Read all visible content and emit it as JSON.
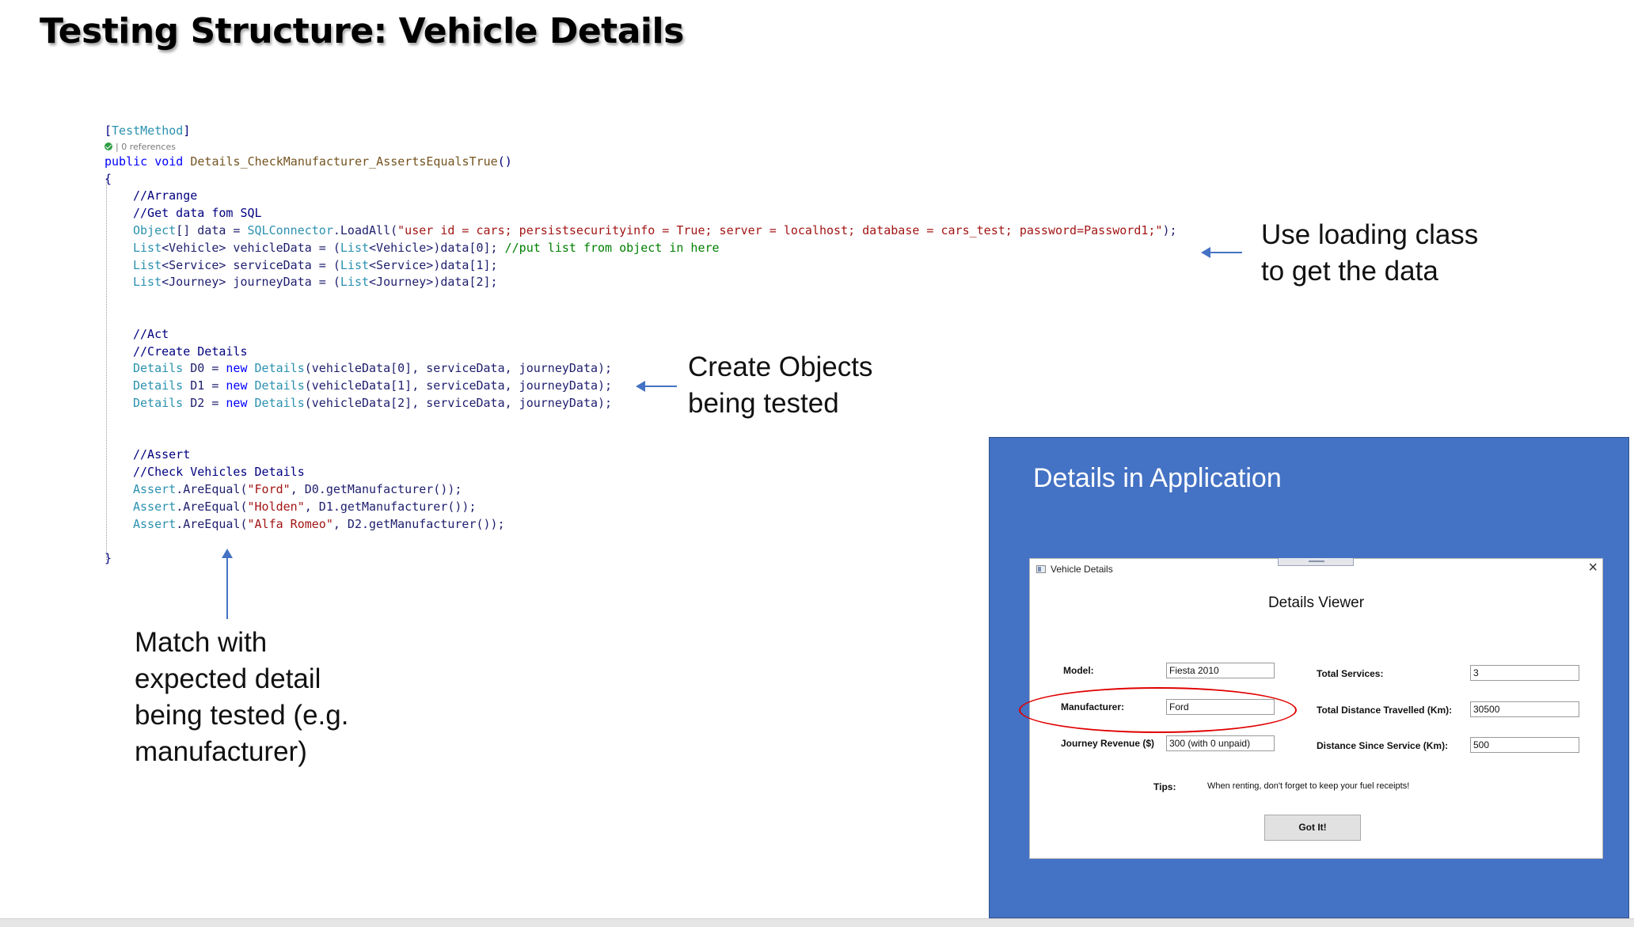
{
  "slide": {
    "title": "Testing Structure: Vehicle Details"
  },
  "code": {
    "attr_open": "[",
    "attr_name": "TestMethod",
    "attr_close": "]",
    "refs": "| 0 references",
    "sig_kw": "public void ",
    "sig_name": "Details_CheckManufacturer_AssertsEqualsTrue",
    "sig_end": "()",
    "open_brace": "{",
    "close_brace": "}",
    "c_arrange": "//Arrange",
    "c_getdata": "//Get data fom SQL",
    "l1_type": "Object",
    "l1_a": "[] data = ",
    "l1_cls": "SQLConnector",
    "l1_b": ".LoadAll(",
    "l1_str": "\"user id = cars; persistsecurityinfo = True; server = localhost; database = cars_test; password=Password1;\"",
    "l1_c": ");",
    "l2_list": "List",
    "l2_t": "<Vehicle>",
    "l2_a": " vehicleData = (",
    "l2_list2": "List",
    "l2_t2": "<Vehicle>",
    "l2_b": ")data[0]; ",
    "l2_cmt": "//put list from object in here",
    "l3_list": "List",
    "l3_t": "<Service>",
    "l3_a": " serviceData = (",
    "l3_list2": "List",
    "l3_t2": "<Service>",
    "l3_b": ")data[1];",
    "l4_list": "List",
    "l4_t": "<Journey>",
    "l4_a": " journeyData = (",
    "l4_list2": "List",
    "l4_t2": "<Journey>",
    "l4_b": ")data[2];",
    "c_act": "//Act",
    "c_create": "//Create Details",
    "d_type": "Details",
    "d0_var": " D0 = ",
    "d1_var": " D1 = ",
    "d2_var": " D2 = ",
    "new_kw": "new ",
    "d0_args": "(vehicleData[0], serviceData, journeyData);",
    "d1_args": "(vehicleData[1], serviceData, journeyData);",
    "d2_args": "(vehicleData[2], serviceData, journeyData);",
    "c_assert": "//Assert",
    "c_check": "//Check Vehicles Details",
    "assert_cls": "Assert",
    "assert_m": ".AreEqual(",
    "a0_str": "\"Ford\"",
    "a0_rest": ", D0.getManufacturer());",
    "a1_str": "\"Holden\"",
    "a1_rest": ", D1.getManufacturer());",
    "a2_str": "\"Alfa Romeo\"",
    "a2_rest": ", D2.getManufacturer());"
  },
  "annotations": {
    "loading_1": "Use loading class",
    "loading_2": "to get the data",
    "create_1": "Create Objects",
    "create_2": "being tested",
    "match_1": "Match with",
    "match_2": "expected detail",
    "match_3": "being tested (e.g.",
    "match_4": "manufacturer)"
  },
  "panel": {
    "title": "Details in Application",
    "color": "#4472c4"
  },
  "window": {
    "title": "Vehicle Details",
    "close_icon": "×",
    "heading": "Details Viewer",
    "model_label": "Model:",
    "model_value": "Fiesta 2010",
    "manufacturer_label": "Manufacturer:",
    "manufacturer_value": "Ford",
    "revenue_label": "Journey Revenue ($)",
    "revenue_value": "300 (with 0 unpaid)",
    "services_label": "Total Services:",
    "services_value": "3",
    "distance_label": "Total Distance Travelled (Km):",
    "distance_value": "30500",
    "since_label": "Distance Since Service (Km):",
    "since_value": "500",
    "tips_label": "Tips:",
    "tips_text": "When renting, don't forget to keep your fuel receipts!",
    "button_label": "Got It!"
  },
  "highlight_color": "#e00000"
}
